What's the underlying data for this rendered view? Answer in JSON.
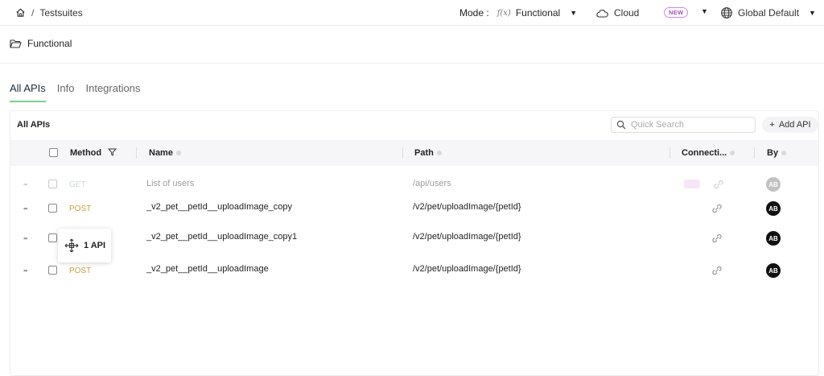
{
  "breadcrumb": {
    "separator": "/",
    "current": "Testsuites"
  },
  "header": {
    "mode_label": "Mode :",
    "mode_value": "Functional",
    "cloud_label": "Cloud",
    "new_badge": "NEW",
    "locale_label": "Global Default"
  },
  "suite": {
    "name": "Functional"
  },
  "tabs": [
    {
      "label": "All APIs",
      "active": true
    },
    {
      "label": "Info",
      "active": false
    },
    {
      "label": "Integrations",
      "active": false
    }
  ],
  "panel": {
    "title": "All APIs",
    "search_placeholder": "Quick Search",
    "add_button": "Add API",
    "columns": {
      "method": "Method",
      "name": "Name",
      "path": "Path",
      "connections": "Connecti...",
      "by": "By"
    }
  },
  "rows": [
    {
      "method": "GET",
      "name": "List of users",
      "path": "/api/users",
      "by": "AB"
    },
    {
      "method": "POST",
      "name": "_v2_pet__petId__uploadImage_copy",
      "path": "/v2/pet/uploadImage/{petId}",
      "by": "AB"
    },
    {
      "method": "",
      "name": "_v2_pet__petId__uploadImage_copy1",
      "path": "/v2/pet/uploadImage/{petId}",
      "by": "AB"
    },
    {
      "method": "POST",
      "name": "_v2_pet__petId__uploadImage",
      "path": "/v2/pet/uploadImage/{petId}",
      "by": "AB"
    }
  ],
  "drag_card": {
    "label": "1 API"
  },
  "colors": {
    "accent": "#7ccf8f",
    "post": "#c9a13b",
    "badge": "#a64fc2"
  }
}
